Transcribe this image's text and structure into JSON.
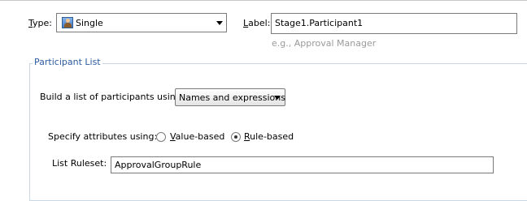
{
  "type_field": {
    "label_mnemonic": "T",
    "label_rest": "ype:",
    "value": "Single",
    "icon": "participant-user-icon"
  },
  "label_field": {
    "label_mnemonic": "L",
    "label_rest": "abel:",
    "value": "Stage1.Participant1",
    "hint": "e.g., Approval Manager"
  },
  "participant_list": {
    "title": "Participant List",
    "build_label": "Build a list of participants using:",
    "build_value": "Names and expressions",
    "specify_label": "Specify attributes using:",
    "options": [
      {
        "mnemonic": "V",
        "rest": "alue-based",
        "selected": false
      },
      {
        "mnemonic": "R",
        "rest": "ule-based",
        "selected": true
      }
    ],
    "ruleset_label": "List Ruleset:",
    "ruleset_value": "ApprovalGroupRule"
  }
}
